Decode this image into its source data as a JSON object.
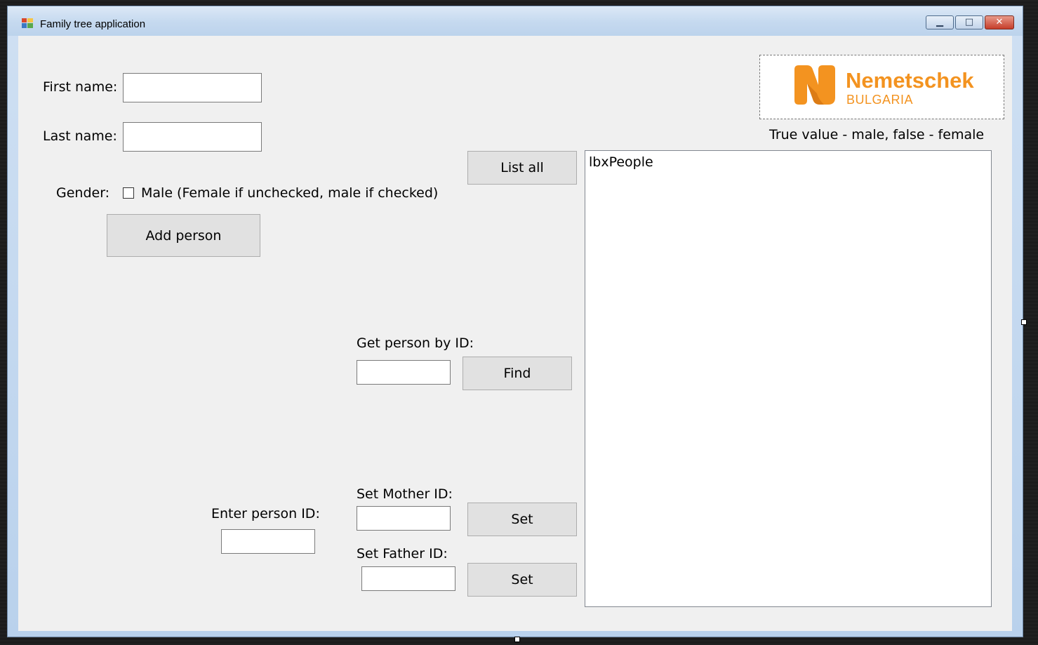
{
  "window": {
    "title": "Family tree application"
  },
  "form": {
    "first_name_label": "First name:",
    "first_name_value": "",
    "last_name_label": "Last name:",
    "last_name_value": "",
    "gender_label": "Gender:",
    "male_checkbox_label": "Male (Female if unchecked, male if checked)",
    "male_checked": false,
    "add_person_button": "Add person",
    "list_all_button": "List all",
    "gender_hint": "True value - male, false - female",
    "get_person_label": "Get person by ID:",
    "get_person_value": "",
    "find_button": "Find",
    "enter_person_id_label": "Enter person ID:",
    "enter_person_id_value": "",
    "set_mother_label": "Set Mother ID:",
    "set_mother_value": "",
    "set_mother_button": "Set",
    "set_father_label": "Set Father ID:",
    "set_father_value": "",
    "set_father_button": "Set",
    "listbox_name": "lbxPeople"
  },
  "logo": {
    "name": "Nemetschek",
    "sub": "BULGARIA",
    "color": "#f39320"
  }
}
